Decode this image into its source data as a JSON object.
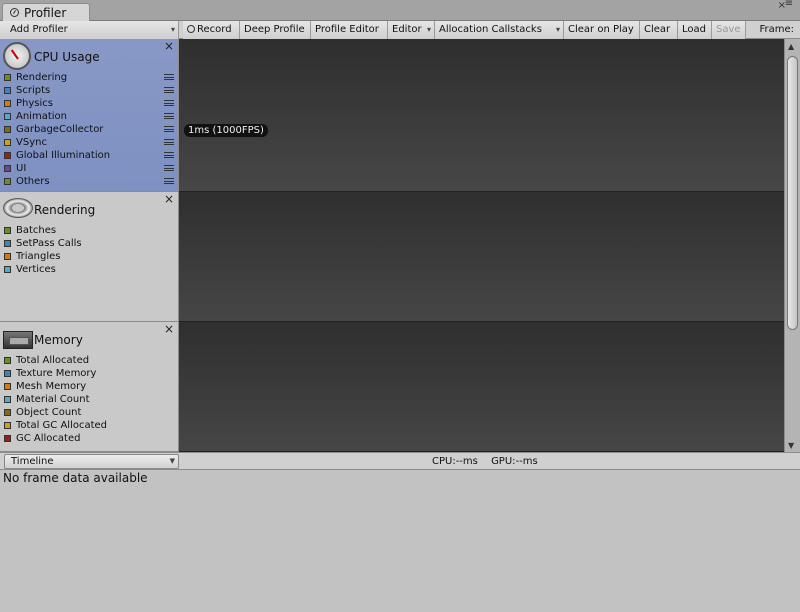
{
  "window": {
    "tab_title": "Profiler",
    "close_glyph": "×",
    "menu_glyph": "≡"
  },
  "toolbar": {
    "add_profiler": "Add Profiler",
    "record": "Record",
    "deep_profile": "Deep Profile",
    "profile_editor": "Profile Editor",
    "editor": "Editor",
    "allocation_callstacks": "Allocation Callstacks",
    "clear_on_play": "Clear on Play",
    "clear": "Clear",
    "load": "Load",
    "save": "Save",
    "frame_label": "Frame:"
  },
  "panels": {
    "cpu": {
      "title": "CPU Usage",
      "icon": "cpu-gauge-icon",
      "items": [
        {
          "label": "Rendering",
          "color": "#6b8f1f"
        },
        {
          "label": "Scripts",
          "color": "#3d86b7"
        },
        {
          "label": "Physics",
          "color": "#d07a17"
        },
        {
          "label": "Animation",
          "color": "#58aac3"
        },
        {
          "label": "GarbageCollector",
          "color": "#7a6c1a"
        },
        {
          "label": "VSync",
          "color": "#c9a417"
        },
        {
          "label": "Global Illumination",
          "color": "#9a2020"
        },
        {
          "label": "UI",
          "color": "#6a4a8a"
        },
        {
          "label": "Others",
          "color": "#6c8a2e"
        }
      ]
    },
    "rendering": {
      "title": "Rendering",
      "icon": "rendering-torus-icon",
      "items": [
        {
          "label": "Batches",
          "color": "#6b8f1f"
        },
        {
          "label": "SetPass Calls",
          "color": "#3d86b7"
        },
        {
          "label": "Triangles",
          "color": "#d07a17"
        },
        {
          "label": "Vertices",
          "color": "#58aac3"
        }
      ]
    },
    "memory": {
      "title": "Memory",
      "icon": "memory-chip-icon",
      "items": [
        {
          "label": "Total Allocated",
          "color": "#6b8f1f"
        },
        {
          "label": "Texture Memory",
          "color": "#3d86b7"
        },
        {
          "label": "Mesh Memory",
          "color": "#d07a17"
        },
        {
          "label": "Material Count",
          "color": "#58aac3"
        },
        {
          "label": "Object Count",
          "color": "#7a6c1a"
        },
        {
          "label": "Total GC Allocated",
          "color": "#c9a417"
        },
        {
          "label": "GC Allocated",
          "color": "#9a2020"
        }
      ]
    }
  },
  "graph": {
    "cpu_fps_label": "1ms (1000FPS)"
  },
  "detail": {
    "view_mode": "Timeline",
    "cpu_time": "CPU:--ms",
    "gpu_time": "GPU:--ms",
    "empty_message": "No frame data available"
  }
}
